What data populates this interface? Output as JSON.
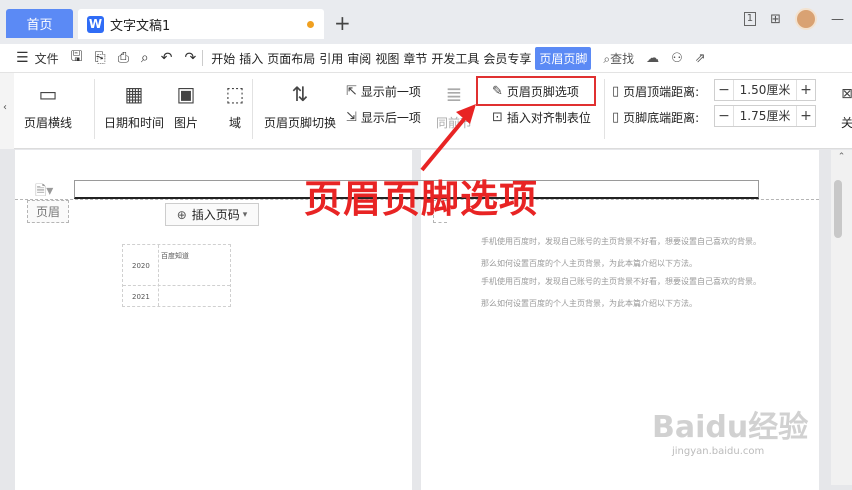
{
  "tabs": {
    "home": "首页",
    "doc": "文字文稿1",
    "add": "+"
  },
  "window": {
    "num": "1"
  },
  "menubar": {
    "file": "文件",
    "items": [
      "开始",
      "插入",
      "页面布局",
      "引用",
      "审阅",
      "视图",
      "章节",
      "开发工具",
      "会员专享"
    ],
    "active": "页眉页脚",
    "search": "查找"
  },
  "ribbon": {
    "header_line": "页眉横线",
    "date_time": "日期和时间",
    "picture": "图片",
    "field": "域",
    "switch": "页眉页脚切换",
    "show_prev": "显示前一项",
    "show_next": "显示后一项",
    "prev_section": "同前节",
    "options": "页眉页脚选项",
    "insert_align": "插入对齐制表位",
    "top_label": "页眉顶端距离:",
    "top_value": "1.50厘米",
    "bottom_label": "页脚底端距离:",
    "bottom_value": "1.75厘米",
    "close": "关"
  },
  "doc": {
    "header_tag": "页眉",
    "insert_page": "插入页码",
    "table": {
      "r1": "2020",
      "r2": "2021",
      "h": "百度知道"
    },
    "lines": [
      "手机使用百度时，发现自己账号的主页背景不好看，想要设置自己喜欢的背景。",
      "那么如何设置百度的个人主页背景，为此本篇介绍以下方法。",
      "手机使用百度时，发现自己账号的主页背景不好看，想要设置自己喜欢的背景。",
      "那么如何设置百度的个人主页背景，为此本篇介绍以下方法。"
    ]
  },
  "annotation": "页眉页脚选项",
  "watermark": {
    "logo": "Baidu经验",
    "url": "jingyan.baidu.com"
  },
  "colors": {
    "accent": "#5b8af5",
    "annotation": "#e82424",
    "highlight": "#e03030"
  }
}
